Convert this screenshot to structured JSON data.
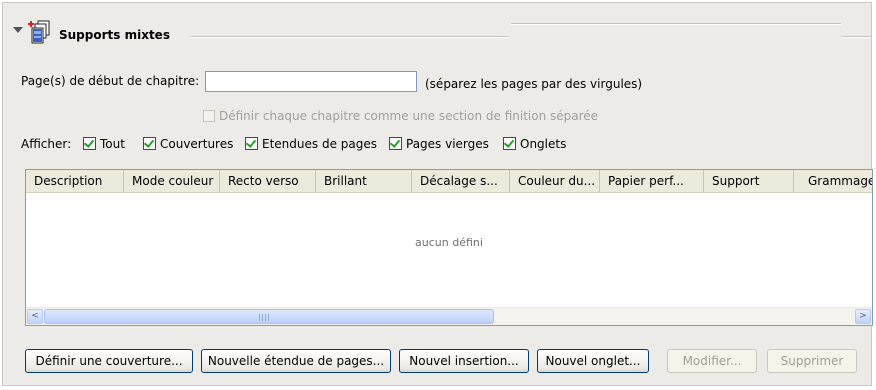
{
  "section": {
    "title": "Supports mixtes",
    "icon": "mixed-media-pages-icon"
  },
  "chapter": {
    "label": "Page(s) de début de chapitre:",
    "value": "",
    "hint": "(séparez les pages par des virgules)",
    "finishing_checkbox_label": "Définir chaque chapitre comme une section de finition séparée",
    "finishing_checked": false
  },
  "filter": {
    "label": "Afficher:",
    "options": [
      {
        "label": "Tout",
        "checked": true
      },
      {
        "label": "Couvertures",
        "checked": true
      },
      {
        "label": "Etendues de pages",
        "checked": true
      },
      {
        "label": "Pages vierges",
        "checked": true
      },
      {
        "label": "Onglets",
        "checked": true
      }
    ]
  },
  "table": {
    "columns": [
      "Description",
      "Mode couleur",
      "Recto verso",
      "Brillant",
      "Décalage s...",
      "Couleur du...",
      "Papier perf...",
      "Support",
      "Grammage."
    ],
    "empty_message": "aucun défini",
    "scroll_left": "<",
    "scroll_right": ">"
  },
  "buttons": {
    "define_cover": "Définir une couverture...",
    "new_page_range": "Nouvelle étendue de pages...",
    "new_insertion": "Nouvel insertion...",
    "new_tab": "Nouvel onglet...",
    "modify": "Modifier...",
    "delete": "Supprimer"
  },
  "colors": {
    "panel_bg": "#ecebe8",
    "check_green": "#21a121",
    "field_border": "#7f9db9",
    "button_border": "#003c74"
  }
}
